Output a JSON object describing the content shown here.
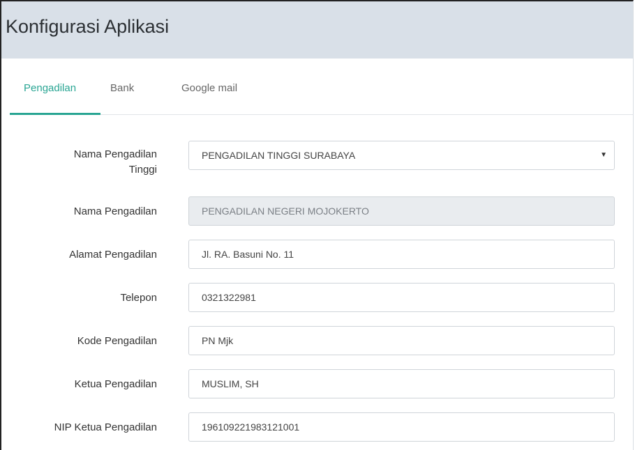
{
  "page": {
    "title": "Konfigurasi Aplikasi"
  },
  "tabs": [
    {
      "label": "Pengadilan",
      "active": true
    },
    {
      "label": "Bank",
      "active": false
    },
    {
      "label": "Google mail",
      "active": false
    }
  ],
  "form": {
    "pengadilan_tinggi": {
      "label_line1": "Nama Pengadilan",
      "label_line2": "Tinggi",
      "value": "PENGADILAN TINGGI SURABAYA"
    },
    "nama_pengadilan": {
      "label": "Nama Pengadilan",
      "value": "PENGADILAN NEGERI MOJOKERTO"
    },
    "alamat": {
      "label": "Alamat Pengadilan",
      "value": "Jl. RA. Basuni No. 11"
    },
    "telepon": {
      "label": "Telepon",
      "value": "0321322981"
    },
    "kode": {
      "label": "Kode Pengadilan",
      "value": "PN Mjk"
    },
    "ketua": {
      "label": "Ketua Pengadilan",
      "value": "MUSLIM, SH"
    },
    "nip_ketua": {
      "label": "NIP Ketua Pengadilan",
      "value": "196109221983121001"
    }
  },
  "colors": {
    "accent": "#29a593",
    "header_bg": "#d9e0e8"
  },
  "icons": {
    "select_caret": "caret-down-icon"
  }
}
